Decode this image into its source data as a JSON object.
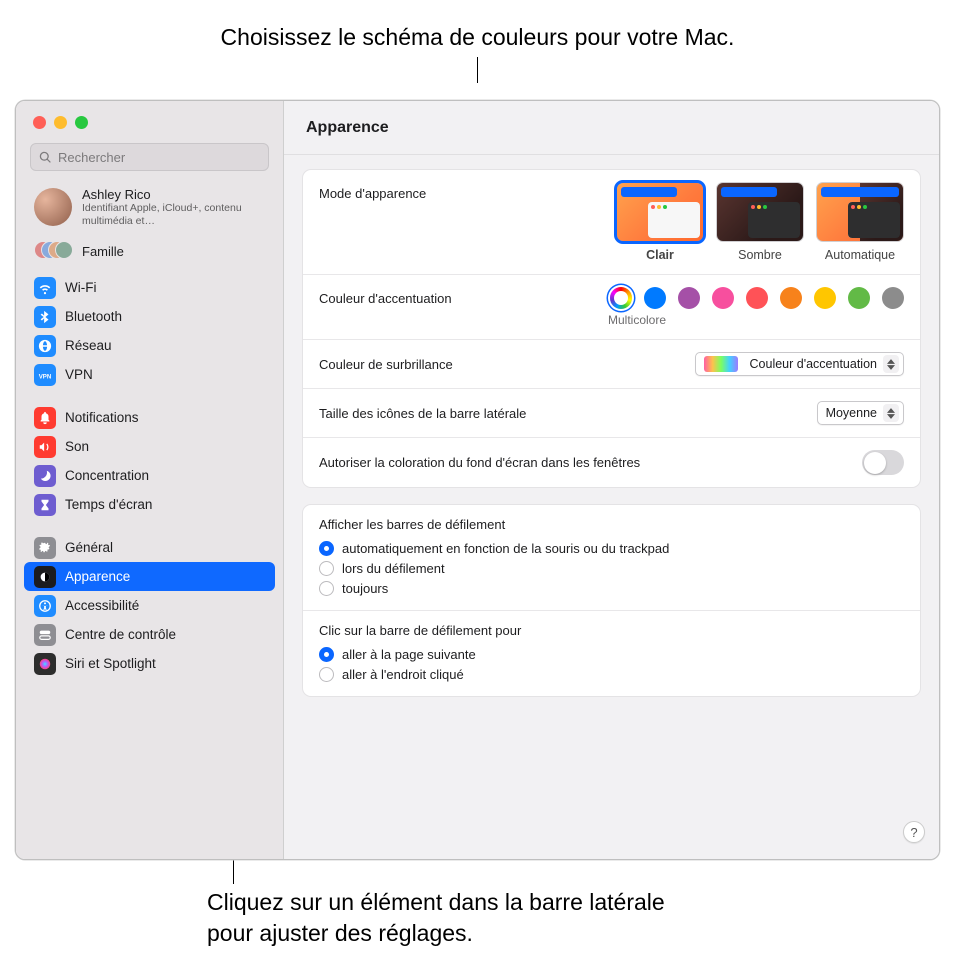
{
  "callout_top": "Choisissez le schéma de couleurs pour votre Mac.",
  "callout_bottom": "Cliquez sur un élément dans la barre latérale pour ajuster des réglages.",
  "search": {
    "placeholder": "Rechercher"
  },
  "profile": {
    "name": "Ashley Rico",
    "sub": "Identifiant Apple, iCloud+, contenu multimédia et…"
  },
  "family": {
    "label": "Famille"
  },
  "sidebar": {
    "groups": [
      {
        "items": [
          {
            "id": "wifi",
            "label": "Wi-Fi",
            "color": "#1f8cff",
            "icon": "wifi"
          },
          {
            "id": "bluetooth",
            "label": "Bluetooth",
            "color": "#1f8cff",
            "icon": "bluetooth"
          },
          {
            "id": "network",
            "label": "Réseau",
            "color": "#1f8cff",
            "icon": "globe"
          },
          {
            "id": "vpn",
            "label": "VPN",
            "color": "#1f8cff",
            "icon": "vpn"
          }
        ]
      },
      {
        "items": [
          {
            "id": "notifications",
            "label": "Notifications",
            "color": "#ff3b30",
            "icon": "bell"
          },
          {
            "id": "sound",
            "label": "Son",
            "color": "#ff3b30",
            "icon": "speaker"
          },
          {
            "id": "focus",
            "label": "Concentration",
            "color": "#6e5dd0",
            "icon": "moon"
          },
          {
            "id": "screentime",
            "label": "Temps d'écran",
            "color": "#6e5dd0",
            "icon": "hourglass"
          }
        ]
      },
      {
        "items": [
          {
            "id": "general",
            "label": "Général",
            "color": "#8e8e93",
            "icon": "gear"
          },
          {
            "id": "appearance",
            "label": "Apparence",
            "color": "#1c1c1e",
            "icon": "appearance",
            "selected": true
          },
          {
            "id": "accessibility",
            "label": "Accessibilité",
            "color": "#1f8cff",
            "icon": "accessibility"
          },
          {
            "id": "controlcenter",
            "label": "Centre de contrôle",
            "color": "#8e8e93",
            "icon": "controlcenter"
          },
          {
            "id": "siri",
            "label": "Siri et Spotlight",
            "color": "#2d2d2d",
            "icon": "siri"
          }
        ]
      }
    ]
  },
  "main": {
    "title": "Apparence",
    "appearance_label": "Mode d'apparence",
    "appearance_options": [
      {
        "id": "light",
        "label": "Clair",
        "selected": true
      },
      {
        "id": "dark",
        "label": "Sombre"
      },
      {
        "id": "auto",
        "label": "Automatique"
      }
    ],
    "accent_label": "Couleur d'accentuation",
    "accent_caption": "Multicolore",
    "accent_colors": [
      {
        "id": "multi",
        "hex": "multi",
        "selected": true
      },
      {
        "id": "blue",
        "hex": "#007aff"
      },
      {
        "id": "purple",
        "hex": "#a550a7"
      },
      {
        "id": "pink",
        "hex": "#f74f9e"
      },
      {
        "id": "red",
        "hex": "#ff5257"
      },
      {
        "id": "orange",
        "hex": "#f7821b"
      },
      {
        "id": "yellow",
        "hex": "#ffc600"
      },
      {
        "id": "green",
        "hex": "#62ba46"
      },
      {
        "id": "graphite",
        "hex": "#8c8c8c"
      }
    ],
    "highlight_label": "Couleur de surbrillance",
    "highlight_value": "Couleur d'accentuation",
    "sidebar_icon_label": "Taille des icônes de la barre latérale",
    "sidebar_icon_value": "Moyenne",
    "wallpaper_tint_label": "Autoriser la coloration du fond d'écran dans les fenêtres",
    "wallpaper_tint_on": false,
    "scroll_show": {
      "title": "Afficher les barres de défilement",
      "options": [
        {
          "label": "automatiquement en fonction de la souris ou du trackpad",
          "checked": true
        },
        {
          "label": "lors du défilement",
          "checked": false
        },
        {
          "label": "toujours",
          "checked": false
        }
      ]
    },
    "scroll_click": {
      "title": "Clic sur la barre de défilement pour",
      "options": [
        {
          "label": "aller à la page suivante",
          "checked": true
        },
        {
          "label": "aller à l'endroit cliqué",
          "checked": false
        }
      ]
    },
    "help": "?"
  }
}
